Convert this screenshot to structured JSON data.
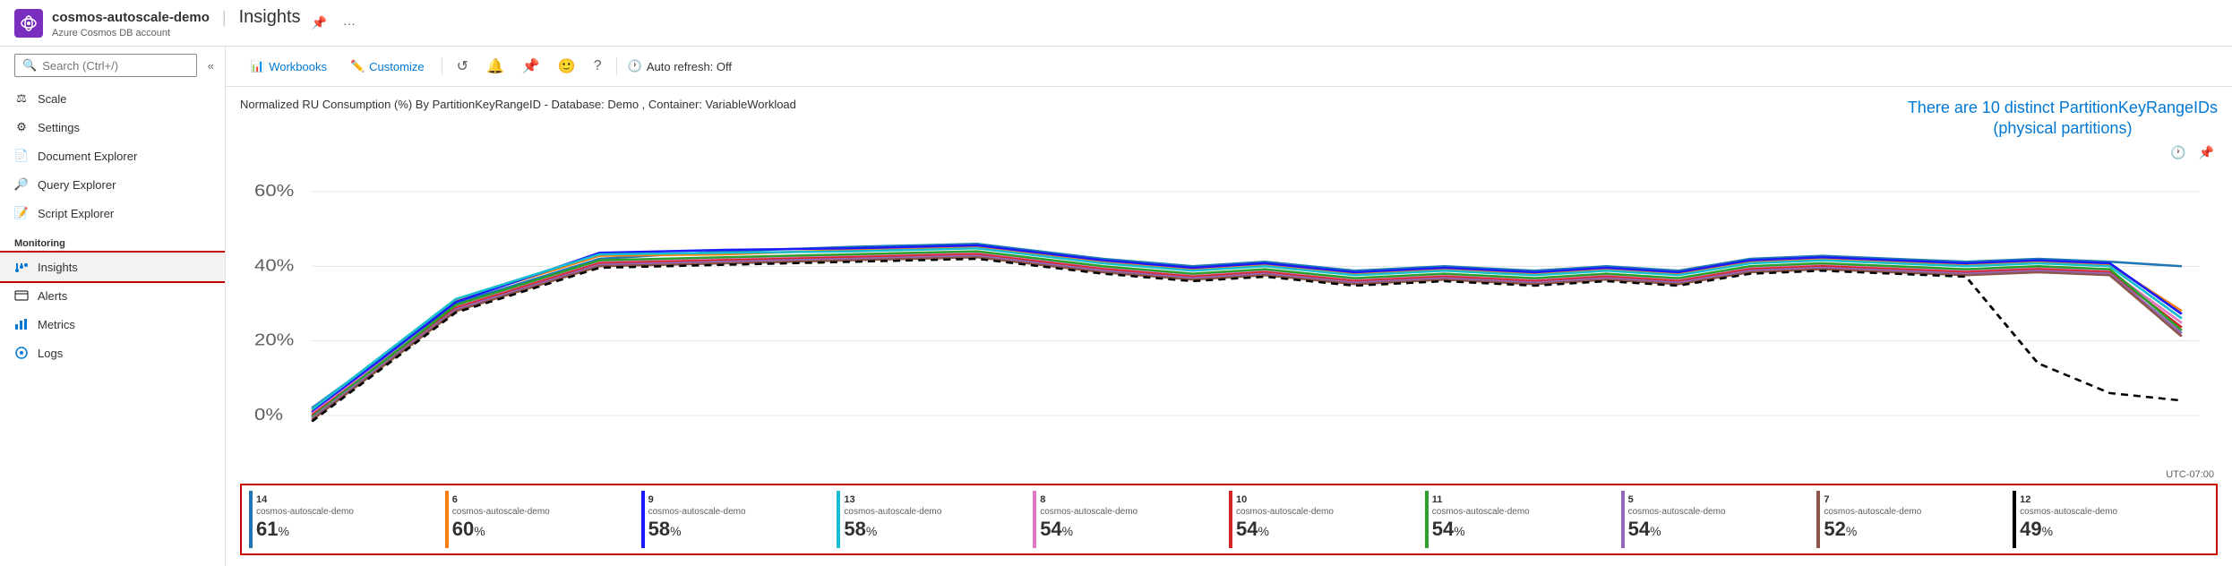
{
  "header": {
    "app_name": "cosmos-autoscale-demo",
    "subtitle": "Azure Cosmos DB account",
    "page_title": "Insights",
    "pin_label": "Pin",
    "more_label": "More"
  },
  "toolbar": {
    "workbooks_label": "Workbooks",
    "customize_label": "Customize",
    "auto_refresh_label": "Auto refresh: Off"
  },
  "sidebar": {
    "search_placeholder": "Search (Ctrl+/)",
    "items": [
      {
        "id": "scale",
        "label": "Scale",
        "icon": "scale"
      },
      {
        "id": "settings",
        "label": "Settings",
        "icon": "settings"
      },
      {
        "id": "document-explorer",
        "label": "Document Explorer",
        "icon": "document"
      },
      {
        "id": "query-explorer",
        "label": "Query Explorer",
        "icon": "query"
      },
      {
        "id": "script-explorer",
        "label": "Script Explorer",
        "icon": "script"
      }
    ],
    "monitoring_label": "Monitoring",
    "monitoring_items": [
      {
        "id": "insights",
        "label": "Insights",
        "icon": "insights",
        "active": true
      },
      {
        "id": "alerts",
        "label": "Alerts",
        "icon": "alerts"
      },
      {
        "id": "metrics",
        "label": "Metrics",
        "icon": "metrics"
      },
      {
        "id": "logs",
        "label": "Logs",
        "icon": "logs"
      }
    ]
  },
  "chart": {
    "title": "Normalized RU Consumption (%) By PartitionKeyRangeID - Database: Demo , Container: VariableWorkload",
    "partition_note_line1": "There are 10 distinct PartitionKeyRangeIDs",
    "partition_note_line2": "(physical partitions)",
    "y_labels": [
      "60%",
      "40%",
      "20%",
      "0%"
    ],
    "utc_label": "UTC-07:00",
    "legend": [
      {
        "id": "14",
        "name": "cosmos-autoscale-demo",
        "pct": "61",
        "color": "#1f77b4"
      },
      {
        "id": "6",
        "name": "cosmos-autoscale-demo",
        "pct": "60",
        "color": "#ff7f0e"
      },
      {
        "id": "9",
        "name": "cosmos-autoscale-demo",
        "pct": "58",
        "color": "#1a1aff"
      },
      {
        "id": "13",
        "name": "cosmos-autoscale-demo",
        "pct": "58",
        "color": "#17becf"
      },
      {
        "id": "8",
        "name": "cosmos-autoscale-demo",
        "pct": "54",
        "color": "#e377c2"
      },
      {
        "id": "10",
        "name": "cosmos-autoscale-demo",
        "pct": "54",
        "color": "#d62728"
      },
      {
        "id": "11",
        "name": "cosmos-autoscale-demo",
        "pct": "54",
        "color": "#2ca02c"
      },
      {
        "id": "5",
        "name": "cosmos-autoscale-demo",
        "pct": "54",
        "color": "#9467bd"
      },
      {
        "id": "7",
        "name": "cosmos-autoscale-demo",
        "pct": "52",
        "color": "#8c564b"
      },
      {
        "id": "12",
        "name": "cosmos-autoscale-demo",
        "pct": "49",
        "color": "#000000"
      }
    ]
  }
}
